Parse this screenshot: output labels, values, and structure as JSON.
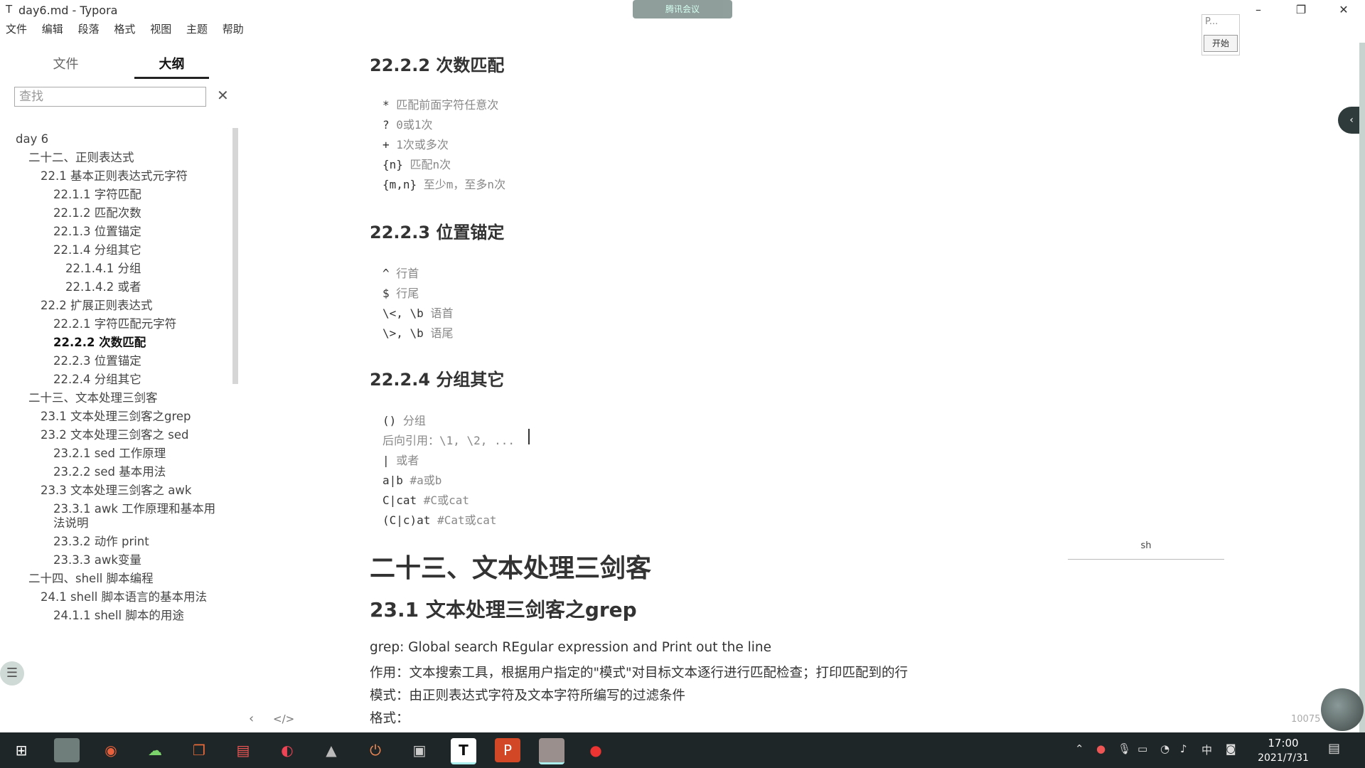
{
  "window": {
    "app_icon": "T",
    "title": "day6.md - Typora",
    "meeting_label": "腾讯会议"
  },
  "menu": [
    "文件",
    "编辑",
    "段落",
    "格式",
    "视图",
    "主题",
    "帮助"
  ],
  "sidebar": {
    "tabs": [
      "文件",
      "大纲"
    ],
    "active_tab": "大纲",
    "search_placeholder": "查找",
    "outline": [
      {
        "text": "day 6",
        "level": 0
      },
      {
        "text": "二十二、正则表达式",
        "level": 1
      },
      {
        "text": "22.1 基本正则表达式元字符",
        "level": 2
      },
      {
        "text": "22.1.1 字符匹配",
        "level": 3
      },
      {
        "text": "22.1.2 匹配次数",
        "level": 3
      },
      {
        "text": "22.1.3 位置锚定",
        "level": 3
      },
      {
        "text": "22.1.4 分组其它",
        "level": 3
      },
      {
        "text": "22.1.4.1 分组",
        "level": 4
      },
      {
        "text": "22.1.4.2 或者",
        "level": 4
      },
      {
        "text": "22.2 扩展正则表达式",
        "level": 2
      },
      {
        "text": "22.2.1 字符匹配元字符",
        "level": 3
      },
      {
        "text": "22.2.2 次数匹配",
        "level": 3,
        "active": true
      },
      {
        "text": "22.2.3 位置锚定",
        "level": 3
      },
      {
        "text": "22.2.4 分组其它",
        "level": 3
      },
      {
        "text": "二十三、文本处理三剑客",
        "level": 1
      },
      {
        "text": "23.1 文本处理三剑客之grep",
        "level": 2
      },
      {
        "text": "23.2 文本处理三剑客之 sed",
        "level": 2
      },
      {
        "text": "23.2.1 sed 工作原理",
        "level": 3
      },
      {
        "text": "23.2.2 sed 基本用法",
        "level": 3
      },
      {
        "text": "23.3 文本处理三剑客之 awk",
        "level": 2
      },
      {
        "text": "23.3.1 awk 工作原理和基本用法说明",
        "level": 3
      },
      {
        "text": "23.3.2 动作 print",
        "level": 3
      },
      {
        "text": "23.3.3 awk变量",
        "level": 3
      },
      {
        "text": "二十四、shell 脚本编程",
        "level": 1
      },
      {
        "text": "24.1 shell 脚本语言的基本用法",
        "level": 2
      },
      {
        "text": "24.1.1 shell 脚本的用途",
        "level": 3
      }
    ]
  },
  "doc": {
    "h_222": "22.2.2 次数匹配",
    "code_222": [
      {
        "sym": "* ",
        "desc": "匹配前面字符任意次"
      },
      {
        "sym": "? ",
        "desc": "0或1次"
      },
      {
        "sym": "+ ",
        "desc": "1次或多次"
      },
      {
        "sym": "{n} ",
        "desc": "匹配n次"
      },
      {
        "sym": "{m,n} ",
        "desc": "至少m，至多n次"
      }
    ],
    "h_223": "22.2.3 位置锚定",
    "code_223": [
      {
        "sym": "^ ",
        "desc": "行首"
      },
      {
        "sym": "$ ",
        "desc": "行尾"
      },
      {
        "sym": "\\<, \\b ",
        "desc": "语首"
      },
      {
        "sym": "\\>, \\b ",
        "desc": "语尾"
      }
    ],
    "h_224": "22.2.4 分组其它",
    "code_224": [
      {
        "sym": "() ",
        "desc": "分组"
      },
      {
        "sym": "",
        "desc": "后向引用：\\1, \\2, ..."
      },
      {
        "sym": "| ",
        "desc": "或者"
      },
      {
        "sym": "a|b ",
        "desc": "#a或b"
      },
      {
        "sym": "C|cat ",
        "desc": "#C或cat"
      },
      {
        "sym": "(C|c)at ",
        "desc": "#Cat或cat"
      }
    ],
    "h1_23": "二十三、文本处理三剑客",
    "h2_231": "23.1 文本处理三剑客之grep",
    "para1": "grep: Global search REgular expression and Print out the line",
    "para2": "作用：文本搜索工具，根据用户指定的\"模式\"对目标文本逐行进行匹配检查；打印匹配到的行",
    "para3": "模式：由正则表达式字符及文本字符所编写的过滤条件",
    "para4": "格式："
  },
  "overlay": {
    "start_widget_label": "P...",
    "start_button": "开始",
    "sh_label": "sh",
    "wordcount": "10075"
  },
  "taskbar": {
    "time": "17:00",
    "date": "2021/7/31",
    "ime": "中"
  }
}
